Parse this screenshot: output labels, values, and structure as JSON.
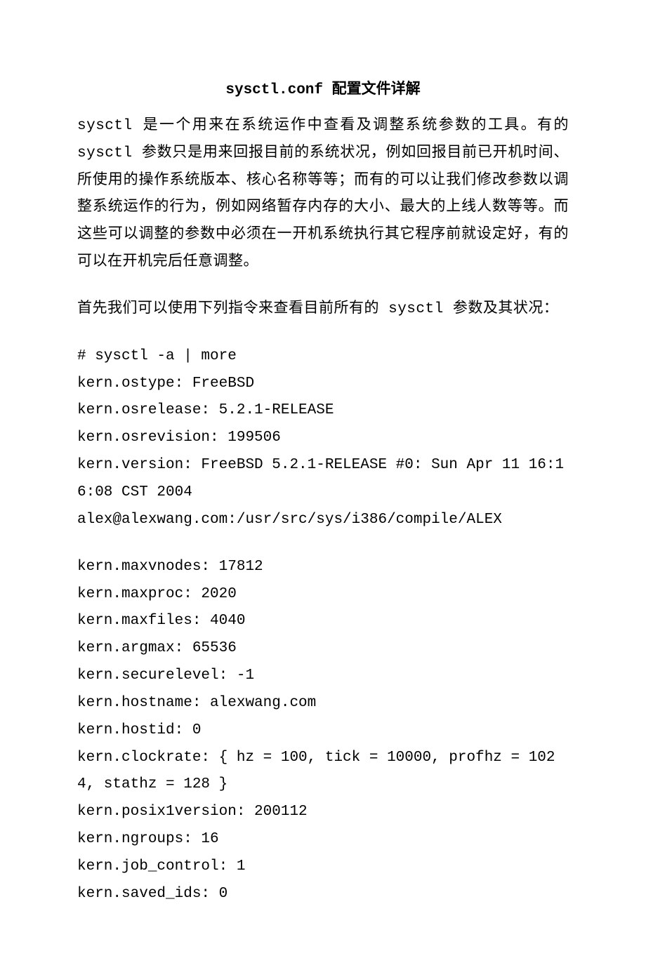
{
  "title": "sysctl.conf 配置文件详解",
  "para1": "sysctl 是一个用来在系统运作中查看及调整系统参数的工具。有的 sysctl 参数只是用来回报目前的系统状况，例如回报目前已开机时间、所使用的操作系统版本、核心名称等等；而有的可以让我们修改参数以调整系统运作的行为，例如网络暂存内存的大小、最大的上线人数等等。而这些可以调整的参数中必须在一开机系统执行其它程序前就设定好，有的可以在开机完后任意调整。",
  "para2": "首先我们可以使用下列指令来查看目前所有的 sysctl 参数及其状况：",
  "block1": [
    "# sysctl -a | more",
    "kern.ostype: FreeBSD",
    "kern.osrelease: 5.2.1-RELEASE",
    "kern.osrevision: 199506",
    "kern.version: FreeBSD 5.2.1-RELEASE #0: Sun Apr 11 16:16:08 CST 2004",
    "alex@alexwang.com:/usr/src/sys/i386/compile/ALEX"
  ],
  "block2": [
    "kern.maxvnodes: 17812",
    "kern.maxproc: 2020",
    "kern.maxfiles: 4040",
    "kern.argmax: 65536",
    "kern.securelevel: -1",
    "kern.hostname: alexwang.com",
    "kern.hostid: 0",
    "kern.clockrate: { hz = 100, tick = 10000, profhz = 1024, stathz = 128 }",
    "kern.posix1version: 200112",
    "kern.ngroups: 16",
    "kern.job_control: 1",
    "kern.saved_ids: 0"
  ]
}
